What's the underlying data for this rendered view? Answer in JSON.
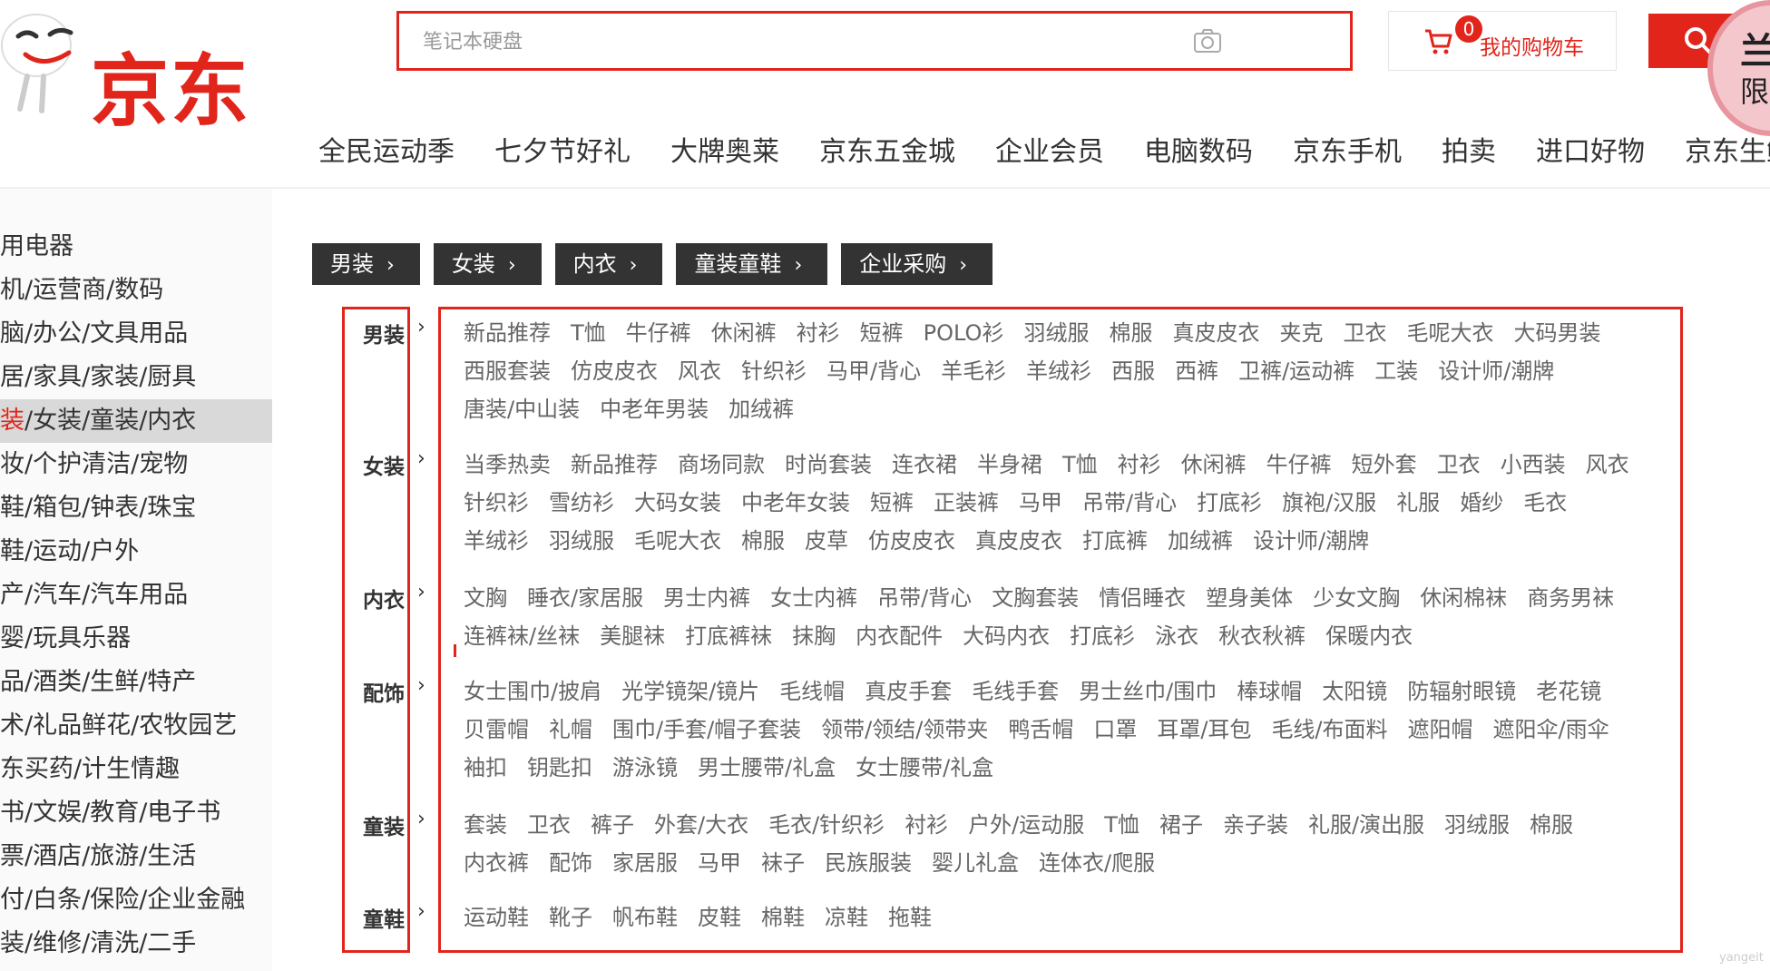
{
  "header": {
    "logo_text": "京东",
    "search_placeholder": "笔记本硬盘",
    "cart": {
      "count": "0",
      "label": "我的购物车"
    },
    "promo": {
      "line1": "兰",
      "line2": "限"
    }
  },
  "nav": [
    "全民运动季",
    "七夕节好礼",
    "大牌奥莱",
    "京东五金城",
    "企业会员",
    "电脑数码",
    "京东手机",
    "拍卖",
    "进口好物",
    "京东生鲜"
  ],
  "categories": [
    "用电器",
    "机/运营商/数码",
    "脑/办公/文具用品",
    "居/家具/家装/厨具",
    "装/女装/童装/内衣",
    "妆/个护清洁/宠物",
    "鞋/箱包/钟表/珠宝",
    "鞋/运动/户外",
    "产/汽车/汽车用品",
    "婴/玩具乐器",
    "品/酒类/生鲜/特产",
    "术/礼品鲜花/农牧园艺",
    "东买药/计生情趣",
    "书/文娱/教育/电子书",
    "票/酒店/旅游/生活",
    "付/白条/保险/企业金融",
    "装/维修/清洗/二手"
  ],
  "active_category_index": 4,
  "tabs": [
    "男装",
    "女装",
    "内衣",
    "童装童鞋",
    "企业采购"
  ],
  "rows": [
    {
      "label": "男装",
      "items": [
        "新品推荐",
        "T恤",
        "牛仔裤",
        "休闲裤",
        "衬衫",
        "短裤",
        "POLO衫",
        "羽绒服",
        "棉服",
        "真皮皮衣",
        "夹克",
        "卫衣",
        "毛呢大衣",
        "大码男装",
        "西服套装",
        "仿皮皮衣",
        "风衣",
        "针织衫",
        "马甲/背心",
        "羊毛衫",
        "羊绒衫",
        "西服",
        "西裤",
        "卫裤/运动裤",
        "工装",
        "设计师/潮牌",
        "唐装/中山装",
        "中老年男装",
        "加绒裤"
      ]
    },
    {
      "label": "女装",
      "items": [
        "当季热卖",
        "新品推荐",
        "商场同款",
        "时尚套装",
        "连衣裙",
        "半身裙",
        "T恤",
        "衬衫",
        "休闲裤",
        "牛仔裤",
        "短外套",
        "卫衣",
        "小西装",
        "风衣",
        "针织衫",
        "雪纺衫",
        "大码女装",
        "中老年女装",
        "短裤",
        "正装裤",
        "马甲",
        "吊带/背心",
        "打底衫",
        "旗袍/汉服",
        "礼服",
        "婚纱",
        "毛衣",
        "羊绒衫",
        "羽绒服",
        "毛呢大衣",
        "棉服",
        "皮草",
        "仿皮皮衣",
        "真皮皮衣",
        "打底裤",
        "加绒裤",
        "设计师/潮牌"
      ]
    },
    {
      "label": "内衣",
      "items": [
        "文胸",
        "睡衣/家居服",
        "男士内裤",
        "女士内裤",
        "吊带/背心",
        "文胸套装",
        "情侣睡衣",
        "塑身美体",
        "少女文胸",
        "休闲棉袜",
        "商务男袜",
        "连裤袜/丝袜",
        "美腿袜",
        "打底裤袜",
        "抹胸",
        "内衣配件",
        "大码内衣",
        "打底衫",
        "泳衣",
        "秋衣秋裤",
        "保暖内衣"
      ]
    },
    {
      "label": "配饰",
      "items": [
        "女士围巾/披肩",
        "光学镜架/镜片",
        "毛线帽",
        "真皮手套",
        "毛线手套",
        "男士丝巾/围巾",
        "棒球帽",
        "太阳镜",
        "防辐射眼镜",
        "老花镜",
        "贝雷帽",
        "礼帽",
        "围巾/手套/帽子套装",
        "领带/领结/领带夹",
        "鸭舌帽",
        "口罩",
        "耳罩/耳包",
        "毛线/布面料",
        "遮阳帽",
        "遮阳伞/雨伞",
        "袖扣",
        "钥匙扣",
        "游泳镜",
        "男士腰带/礼盒",
        "女士腰带/礼盒"
      ]
    },
    {
      "label": "童装",
      "items": [
        "套装",
        "卫衣",
        "裤子",
        "外套/大衣",
        "毛衣/针织衫",
        "衬衫",
        "户外/运动服",
        "T恤",
        "裙子",
        "亲子装",
        "礼服/演出服",
        "羽绒服",
        "棉服",
        "内衣裤",
        "配饰",
        "家居服",
        "马甲",
        "袜子",
        "民族服装",
        "婴儿礼盒",
        "连体衣/爬服"
      ]
    },
    {
      "label": "童鞋",
      "items": [
        "运动鞋",
        "靴子",
        "帆布鞋",
        "皮鞋",
        "棉鞋",
        "凉鞋",
        "拖鞋"
      ]
    }
  ],
  "watermark": "yangeit",
  "colors": {
    "brand_red": "#e1251b",
    "tab_bg": "#333333",
    "active_category_bg": "#d9d9d9"
  }
}
